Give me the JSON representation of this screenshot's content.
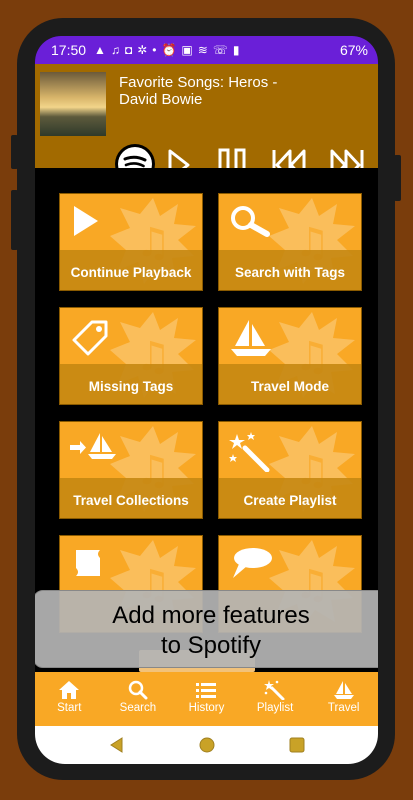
{
  "status": {
    "time": "17:50",
    "battery": "67%"
  },
  "now_playing": {
    "title": "Favorite Songs: Heros -",
    "artist": "David Bowie"
  },
  "tiles": [
    {
      "label": "Continue Playback",
      "icon": "play-icon"
    },
    {
      "label": "Search with Tags",
      "icon": "search-icon"
    },
    {
      "label": "Missing Tags",
      "icon": "tag-icon"
    },
    {
      "label": "Travel Mode",
      "icon": "sailboat-icon"
    },
    {
      "label": "Travel Collections",
      "icon": "arrow-sailboat-icon"
    },
    {
      "label": "Create Playlist",
      "icon": "magic-wand-icon"
    },
    {
      "label": "",
      "icon": "scroll-icon"
    },
    {
      "label": "",
      "icon": "speech-bubble-icon"
    }
  ],
  "toast": {
    "line1": "Add more features",
    "line2": "to Spotify"
  },
  "bottom_nav": [
    {
      "label": "Start",
      "icon": "home-icon"
    },
    {
      "label": "Search",
      "icon": "search-icon"
    },
    {
      "label": "History",
      "icon": "list-icon"
    },
    {
      "label": "Playlist",
      "icon": "magic-wand-icon"
    },
    {
      "label": "Travel",
      "icon": "sailboat-icon"
    }
  ],
  "colors": {
    "background": "#7a3d0c",
    "accent": "#f9a825",
    "now_playing_bar": "#a26a00",
    "status_bar": "#6a1fd8"
  }
}
